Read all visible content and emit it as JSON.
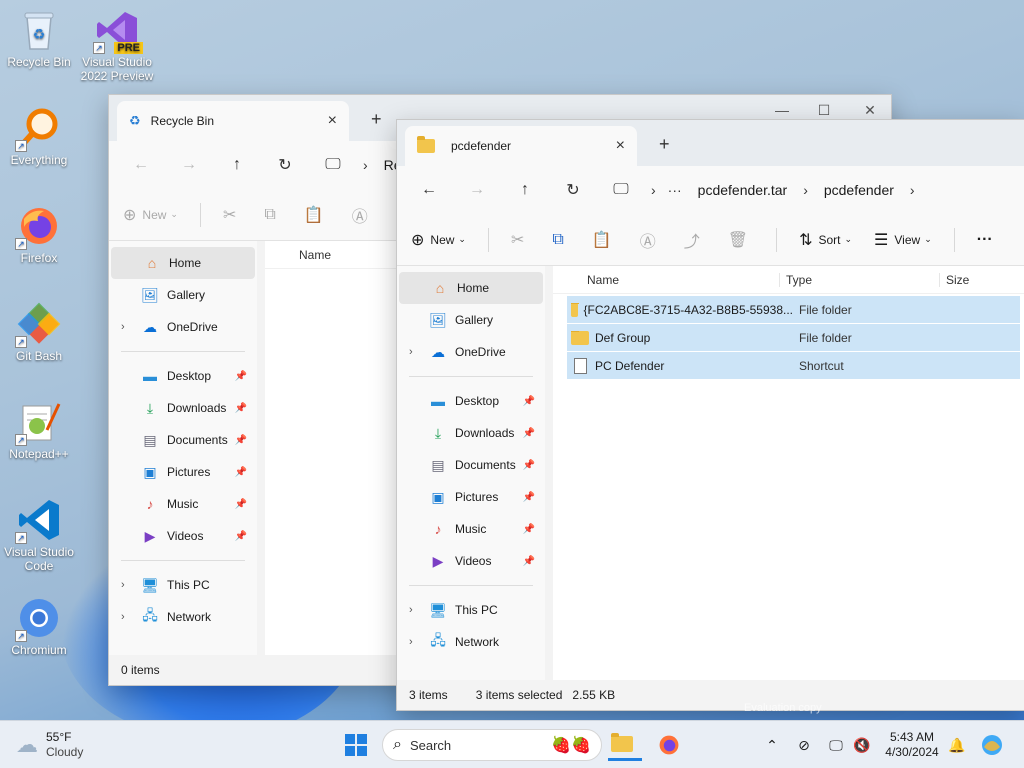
{
  "desktop": {
    "icons": [
      {
        "label": "Recycle Bin"
      },
      {
        "label": "Visual Studio 2022 Preview"
      },
      {
        "label": "Everything"
      },
      {
        "label": "Firefox"
      },
      {
        "label": "Git Bash"
      },
      {
        "label": "Notepad++"
      },
      {
        "label": "Visual Studio Code"
      },
      {
        "label": "Chromium"
      }
    ],
    "vs_badge": "PRE",
    "watermark": "Evaluation copy"
  },
  "recycle_window": {
    "tab_title": "Recycle Bin",
    "breadcrumb": "Re",
    "new_label": "New",
    "sidebar": {
      "home": "Home",
      "gallery": "Gallery",
      "onedrive": "OneDrive",
      "desktop": "Desktop",
      "downloads": "Downloads",
      "documents": "Documents",
      "pictures": "Pictures",
      "music": "Music",
      "videos": "Videos",
      "thispc": "This PC",
      "network": "Network"
    },
    "column_name": "Name",
    "status": "0 items"
  },
  "pcdef_window": {
    "tab_title": "pcdefender",
    "breadcrumb": [
      "pcdefender.tar",
      "pcdefender"
    ],
    "commands": {
      "new": "New",
      "sort": "Sort",
      "view": "View"
    },
    "sidebar": {
      "home": "Home",
      "gallery": "Gallery",
      "onedrive": "OneDrive",
      "desktop": "Desktop",
      "downloads": "Downloads",
      "documents": "Documents",
      "pictures": "Pictures",
      "music": "Music",
      "videos": "Videos",
      "thispc": "This PC",
      "network": "Network"
    },
    "columns": {
      "name": "Name",
      "type": "Type",
      "size": "Size"
    },
    "rows": [
      {
        "name": "{FC2ABC8E-3715-4A32-B8B5-55938...",
        "type": "File folder",
        "kind": "folder"
      },
      {
        "name": "Def Group",
        "type": "File folder",
        "kind": "folder"
      },
      {
        "name": "PC Defender",
        "type": "Shortcut",
        "kind": "file"
      }
    ],
    "status": {
      "count": "3 items",
      "selected": "3 items selected",
      "size": "2.55 KB"
    }
  },
  "taskbar": {
    "weather_temp": "55°F",
    "weather_desc": "Cloudy",
    "search_placeholder": "Search",
    "time": "5:43 AM",
    "date": "4/30/2024"
  }
}
